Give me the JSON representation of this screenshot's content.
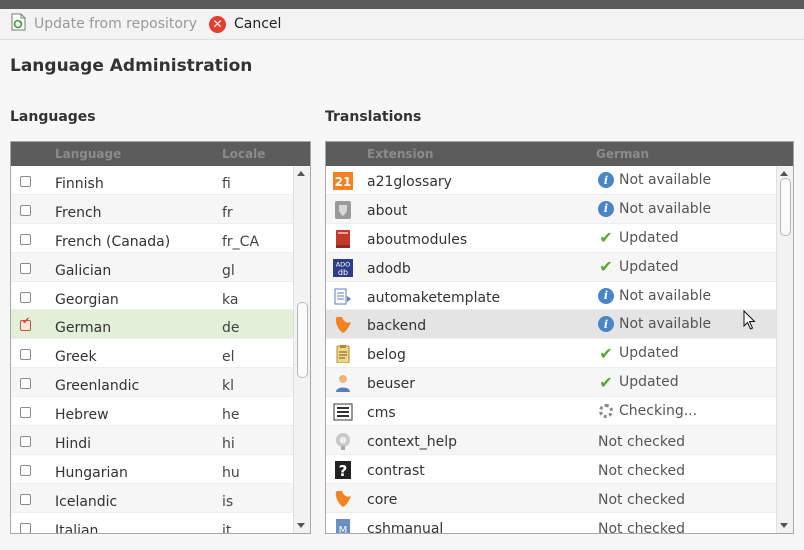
{
  "toolbar": {
    "update_label": "Update from repository",
    "cancel_label": "Cancel"
  },
  "page": {
    "title": "Language Administration",
    "languages_title": "Languages",
    "translations_title": "Translations"
  },
  "languages": {
    "headers": {
      "language": "Language",
      "locale": "Locale"
    },
    "rows": [
      {
        "name": "Finnish",
        "locale": "fi",
        "checked": false
      },
      {
        "name": "French",
        "locale": "fr",
        "checked": false
      },
      {
        "name": "French (Canada)",
        "locale": "fr_CA",
        "checked": false
      },
      {
        "name": "Galician",
        "locale": "gl",
        "checked": false
      },
      {
        "name": "Georgian",
        "locale": "ka",
        "checked": false
      },
      {
        "name": "German",
        "locale": "de",
        "checked": true
      },
      {
        "name": "Greek",
        "locale": "el",
        "checked": false
      },
      {
        "name": "Greenlandic",
        "locale": "kl",
        "checked": false
      },
      {
        "name": "Hebrew",
        "locale": "he",
        "checked": false
      },
      {
        "name": "Hindi",
        "locale": "hi",
        "checked": false
      },
      {
        "name": "Hungarian",
        "locale": "hu",
        "checked": false
      },
      {
        "name": "Icelandic",
        "locale": "is",
        "checked": false
      },
      {
        "name": "Italian",
        "locale": "it",
        "checked": false
      }
    ]
  },
  "translations": {
    "headers": {
      "extension": "Extension",
      "language": "German"
    },
    "rows": [
      {
        "extension": "a21glossary",
        "icon": "a21-icon",
        "status": "Not available",
        "status_icon": "info"
      },
      {
        "extension": "about",
        "icon": "shield-icon",
        "status": "Not available",
        "status_icon": "info"
      },
      {
        "extension": "aboutmodules",
        "icon": "book-icon",
        "status": "Updated",
        "status_icon": "check"
      },
      {
        "extension": "adodb",
        "icon": "adodb-icon",
        "status": "Updated",
        "status_icon": "check"
      },
      {
        "extension": "automaketemplate",
        "icon": "template-icon",
        "status": "Not available",
        "status_icon": "info"
      },
      {
        "extension": "backend",
        "icon": "typo3-icon",
        "status": "Not available",
        "status_icon": "info"
      },
      {
        "extension": "belog",
        "icon": "clipboard-icon",
        "status": "Updated",
        "status_icon": "check"
      },
      {
        "extension": "beuser",
        "icon": "user-icon",
        "status": "Updated",
        "status_icon": "check"
      },
      {
        "extension": "cms",
        "icon": "list-icon",
        "status": "Checking...",
        "status_icon": "spinner"
      },
      {
        "extension": "context_help",
        "icon": "help-icon",
        "status": "Not checked",
        "status_icon": "none"
      },
      {
        "extension": "contrast",
        "icon": "contrast-icon",
        "status": "Not checked",
        "status_icon": "none"
      },
      {
        "extension": "core",
        "icon": "typo3-icon",
        "status": "Not checked",
        "status_icon": "none"
      },
      {
        "extension": "cshmanual",
        "icon": "manual-icon",
        "status": "Not checked",
        "status_icon": "none"
      }
    ]
  },
  "colors": {
    "header_bg": "#5c5c5c",
    "selected_row": "#e3f0d9",
    "hover_row": "#e4e4e4",
    "typo3_orange": "#f58220",
    "updated_green": "#55a830",
    "info_blue": "#4a86c5",
    "cancel_red": "#e2402d"
  }
}
